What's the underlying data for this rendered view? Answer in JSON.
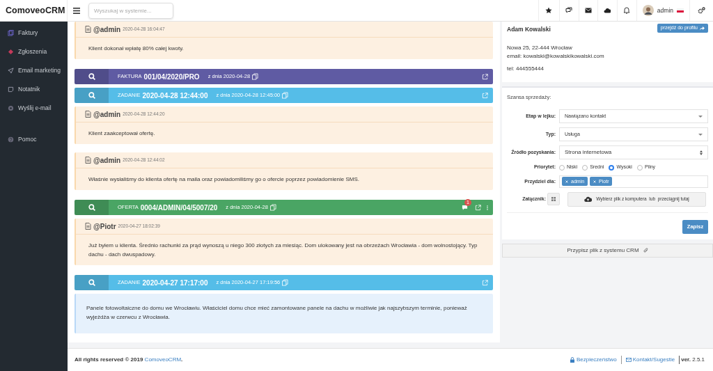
{
  "brand": "ComoveoCRM",
  "search": {
    "placeholder": "Wyszukaj w systemie..."
  },
  "user": {
    "name": "admin"
  },
  "sidebar": {
    "items": [
      {
        "label": "Faktury"
      },
      {
        "label": "Zgłoszenia"
      },
      {
        "label": "Email marketing"
      },
      {
        "label": "Notatnik"
      },
      {
        "label": "Wyślij e-mail"
      }
    ],
    "footer_items": [
      {
        "label": "Pomoc"
      }
    ]
  },
  "timeline": [
    {
      "kind": "note",
      "author": "@admin",
      "time": "2020-04-28 16:04:47",
      "text": "Klient dokonał wpłatę 80% całej kwoty."
    },
    {
      "kind": "record",
      "color": "#5f5ba3",
      "type": "FAKTURA",
      "number": "001/04/2020/PRO",
      "date": "z dnia 2020-04-28"
    },
    {
      "kind": "record",
      "color": "#55bde8",
      "type": "ZADANIE",
      "number": "2020-04-28 12:44:00",
      "date": "z dnia 2020-04-28 12:45:00"
    },
    {
      "kind": "note",
      "author": "@admin",
      "time": "2020-04-28 12:44:20",
      "text": "Klient zaakceptował ofertę."
    },
    {
      "kind": "note",
      "author": "@admin",
      "time": "2020-04-28 12:44:02",
      "text": "Właśnie wysłaliśmy do klienta ofertę na maila oraz powiadomiliśmy go o ofercie poprzez powiadomienie SMS."
    },
    {
      "kind": "record",
      "color": "#4aa564",
      "type": "OFERTA",
      "number": "0004/ADMIN/04/5007/20",
      "date": "z dnia 2020-04-28",
      "comment_count": "1"
    },
    {
      "kind": "note",
      "author": "@Piotr",
      "time": "2020-04-27 18:02:39",
      "text": "Już byłem u klienta. Średnio rachunki za prąd wynoszą u niego 300 złotych za miesiąc. Dom ulokowany jest na obrzeżach Wrocławia - dom wolnostojący. Typ dachu - dach dwuspadowy."
    },
    {
      "kind": "record",
      "color": "#55bde8",
      "type": "ZADANIE",
      "number": "2020-04-27 17:17:00",
      "date": "z dnia 2020-04-27 17:19:56"
    },
    {
      "kind": "description",
      "text": "Panele fotowoltaiczne do domu we Wrocławiu. Właściciel domu chce mieć zamontowane panele na dachu w możliwie jak najszybszym terminie, ponieważ wyjeżdża w czerwcu z Wrocławia."
    }
  ],
  "contact": {
    "name": "Adam Kowalski",
    "profile_button": "przejdź do profilu",
    "address": "Nowa 25, 22-444 Wrocław",
    "email": "email: kowalski@kowalskikowalski.com",
    "phone": "tel: 444555444"
  },
  "sales": {
    "title": "Szansa sprzedaży:",
    "fields": [
      {
        "kind": "select",
        "label": "Etap w lejku:",
        "value": "Nawiązano kontakt"
      },
      {
        "kind": "select",
        "label": "Typ:",
        "value": "Usługa"
      },
      {
        "kind": "native-select",
        "label": "Źródło pozyskania:",
        "value": "Strona internetowa"
      },
      {
        "kind": "radio",
        "label": "Priorytet:",
        "options": [
          {
            "label": "Niski",
            "selected": false
          },
          {
            "label": "Sredni",
            "selected": false
          },
          {
            "label": "Wysoki",
            "selected": true
          },
          {
            "label": "Pilny",
            "selected": false
          }
        ]
      },
      {
        "kind": "tags",
        "label": "Przydziel dla:",
        "tags": [
          "admin",
          "Piotr"
        ]
      },
      {
        "kind": "upload",
        "label": "Załącznik:",
        "text": "Wybierz plik z komputera  lub  przeciągnij tutaj"
      }
    ],
    "save_button": "Zapisz"
  },
  "assign_button": "Przypisz plik z systemu CRM",
  "footer": {
    "copyright": "All rights reserved © 2019 ",
    "brand_link": "ComoveoCRM",
    "copyright_end": ".",
    "links": [
      "Bezpieczeństwo",
      "Kontakt/Sugestie"
    ],
    "version": "**ver.** 2.5.1"
  }
}
